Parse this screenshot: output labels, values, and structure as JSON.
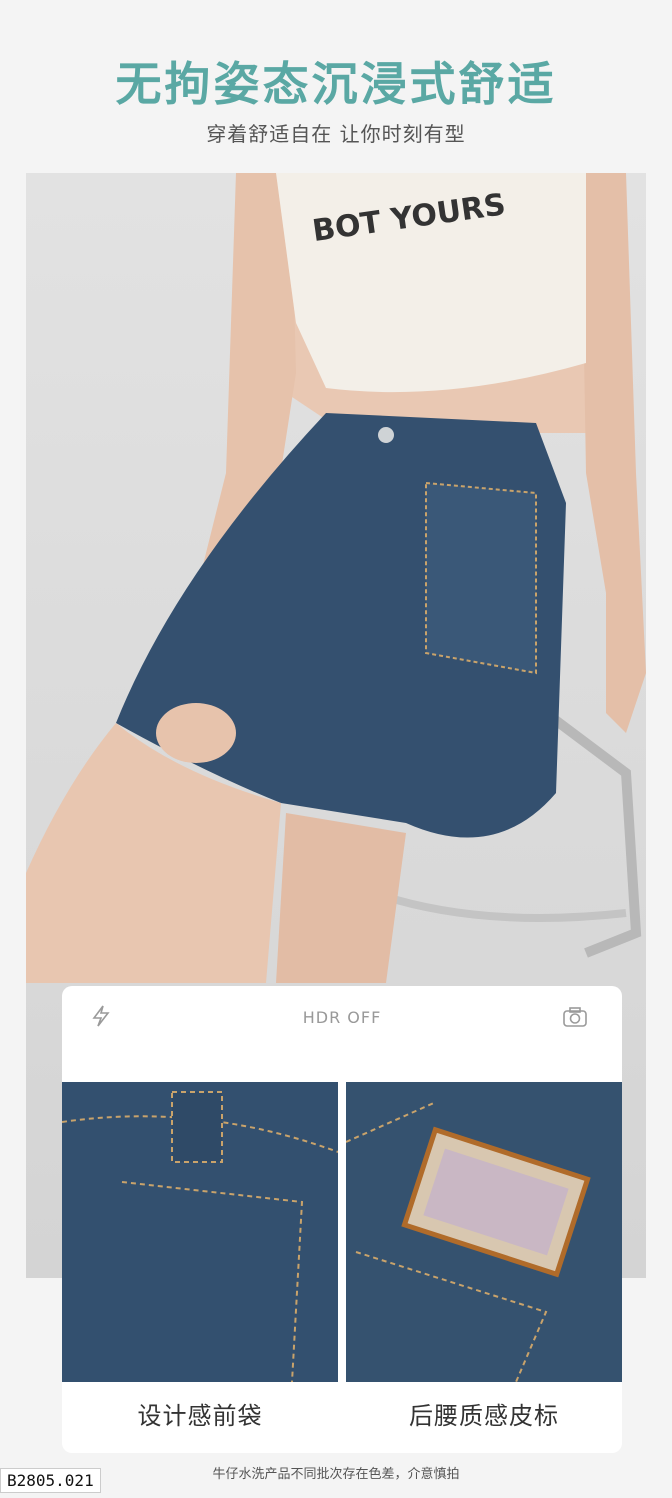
{
  "header": {
    "title": "无拘姿态沉浸式舒适",
    "subtitle": "穿着舒适自在 让你时刻有型"
  },
  "photo": {
    "shirt_print": "BOT YOURS"
  },
  "camera_card": {
    "hdr_label": "HDR OFF",
    "left_icon": "flash-icon",
    "right_icon": "camera-icon",
    "details": [
      {
        "caption": "设计感前袋"
      },
      {
        "caption": "后腰质感皮标"
      }
    ]
  },
  "footnote": "牛仔水洗产品不同批次存在色差，介意慎拍",
  "product_code": "B2805.021",
  "colors": {
    "title": "#5aa8a4",
    "denim": "#34506f"
  }
}
